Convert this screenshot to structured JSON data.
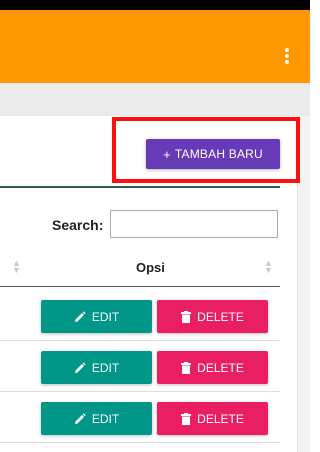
{
  "colors": {
    "appbar": "#ff9800",
    "primary_button": "#673ab7",
    "edit_button": "#009688",
    "delete_button": "#e91e63",
    "highlight_box": "#ff1010"
  },
  "appbar": {
    "menu_icon": "more-vert-icon"
  },
  "toolbar": {
    "add_label": "TAMBAH BARU",
    "add_icon": "+"
  },
  "search": {
    "label": "Search:",
    "value": "",
    "placeholder": ""
  },
  "table": {
    "columns": [
      "Opsi"
    ],
    "rows": [
      {
        "edit_label": "EDIT",
        "delete_label": "DELETE"
      },
      {
        "edit_label": "EDIT",
        "delete_label": "DELETE"
      },
      {
        "edit_label": "EDIT",
        "delete_label": "DELETE"
      }
    ]
  },
  "icons": {
    "edit": "pencil-icon",
    "delete": "trash-icon",
    "sort": "sort-icon"
  }
}
